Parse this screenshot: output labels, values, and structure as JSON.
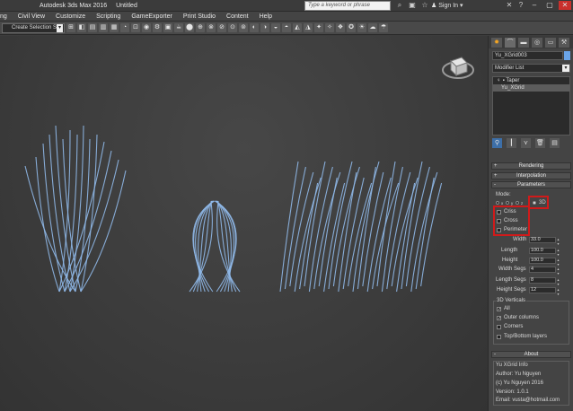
{
  "titlebar": {
    "app_title": "Autodesk 3ds Max 2016",
    "doc_title": "Untitled",
    "search_placeholder": "Type a keyword or phrase",
    "signin": "Sign In"
  },
  "menubar": {
    "items": [
      "ng",
      "Civil View",
      "Customize",
      "Scripting",
      "GameExporter",
      "Print Studio",
      "Content",
      "Help"
    ]
  },
  "toolbar": {
    "selection_set": "Create Selection S"
  },
  "panel": {
    "object_name": "Yu_XGrid003",
    "object_color": "#6aa4e8",
    "modifier_list": "Modifier List",
    "stack": [
      "Taper",
      "Yu_XGrid"
    ],
    "rollouts": {
      "rendering": "Rendering",
      "interpolation": "Interpolation",
      "parameters": "Parameters",
      "about": "About"
    },
    "mode_label": "Mode:",
    "mode_options": [
      "x",
      "y",
      "z",
      "3D"
    ],
    "mode_selected": "3D",
    "checks": [
      "Criss",
      "Cross",
      "Perimeter"
    ],
    "fields": [
      {
        "label": "Width",
        "value": "33.0"
      },
      {
        "label": "Length",
        "value": "100.0"
      },
      {
        "label": "Height",
        "value": "100.0"
      },
      {
        "label": "Width Segs",
        "value": "4"
      },
      {
        "label": "Length Segs",
        "value": "8"
      },
      {
        "label": "Height Segs",
        "value": "12"
      }
    ],
    "verticals": {
      "title": "3D Verticals",
      "items": [
        {
          "label": "All",
          "checked": true
        },
        {
          "label": "Outer columns",
          "checked": true
        },
        {
          "label": "Corners",
          "checked": false
        },
        {
          "label": "Top/Bottom layers",
          "checked": false
        }
      ]
    },
    "info": {
      "title": "Yu XGrid Info",
      "lines": [
        "Author: Yu Nguyen",
        "(c) Yu Nguyen 2016",
        "Version: 1.0.1",
        "Email: vusta@hotmail.com"
      ]
    }
  },
  "colors": {
    "strand": "#8fb8e8",
    "highlight": "#d11a1a"
  }
}
